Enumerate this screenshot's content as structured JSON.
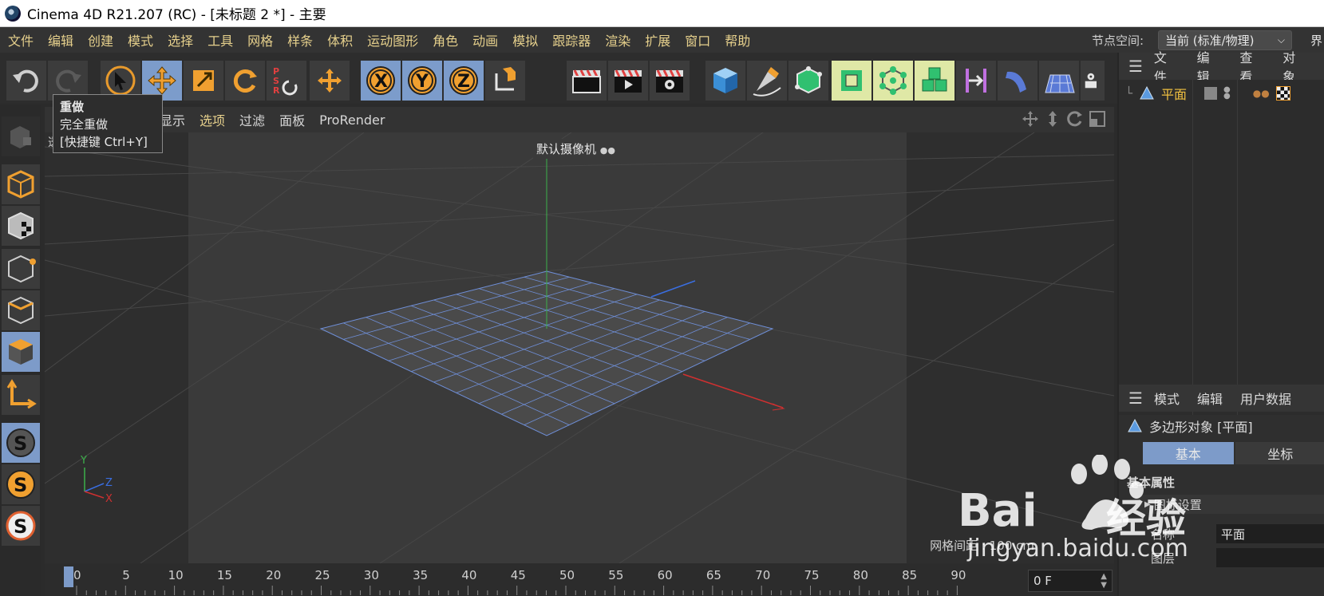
{
  "window": {
    "title": "Cinema 4D R21.207 (RC) - [未标题 2 *] - 主要"
  },
  "menubar": {
    "items": [
      "文件",
      "编辑",
      "创建",
      "模式",
      "选择",
      "工具",
      "网格",
      "样条",
      "体积",
      "运动图形",
      "角色",
      "动画",
      "模拟",
      "跟踪器",
      "渲染",
      "扩展",
      "窗口",
      "帮助"
    ],
    "node_space_label": "节点空间:",
    "node_space_value": "当前 (标准/物理)",
    "cut_text": "界"
  },
  "tooltip": {
    "title": "重做",
    "line1": "完全重做",
    "line2": "[快捷键 Ctrl+Y]"
  },
  "viewport": {
    "menu": [
      "显示",
      "选项",
      "过滤",
      "面板",
      "ProRender"
    ],
    "menu_cut": "机",
    "selected_menu": "选项",
    "camera_label": "默认摄像机",
    "grid_spacing": "网格间距 : 100 cm",
    "axis_labels": {
      "y": "Y",
      "z": "Z",
      "x": "X"
    },
    "left_hint": "透"
  },
  "timeline": {
    "ticks": [
      "0",
      "5",
      "10",
      "15",
      "20",
      "25",
      "30",
      "35",
      "40",
      "45",
      "50",
      "55",
      "60",
      "65",
      "70",
      "75",
      "80",
      "85",
      "90"
    ],
    "current_frame": "0 F"
  },
  "objects_panel": {
    "menu": [
      "文件",
      "编辑",
      "查看",
      "对象"
    ],
    "object_name": "平面"
  },
  "attributes_panel": {
    "menu": [
      "模式",
      "编辑",
      "用户数据"
    ],
    "title": "多边形对象 [平面]",
    "tabs": [
      "基本",
      "坐标"
    ],
    "section": "基本属性",
    "subsection": "图标设置",
    "name_label": "名称",
    "name_value": "平面",
    "layer_label": "图层"
  },
  "watermark": {
    "brand": "Bai",
    "brand2": "经验",
    "url": "jingyan.baidu.com"
  },
  "colors": {
    "menu_text": "#e6d08c",
    "active_tool": "#7c9ccb",
    "highlight_tool": "#dfe8a6",
    "object_name": "#f0c040",
    "background": "#2b2b2b"
  }
}
